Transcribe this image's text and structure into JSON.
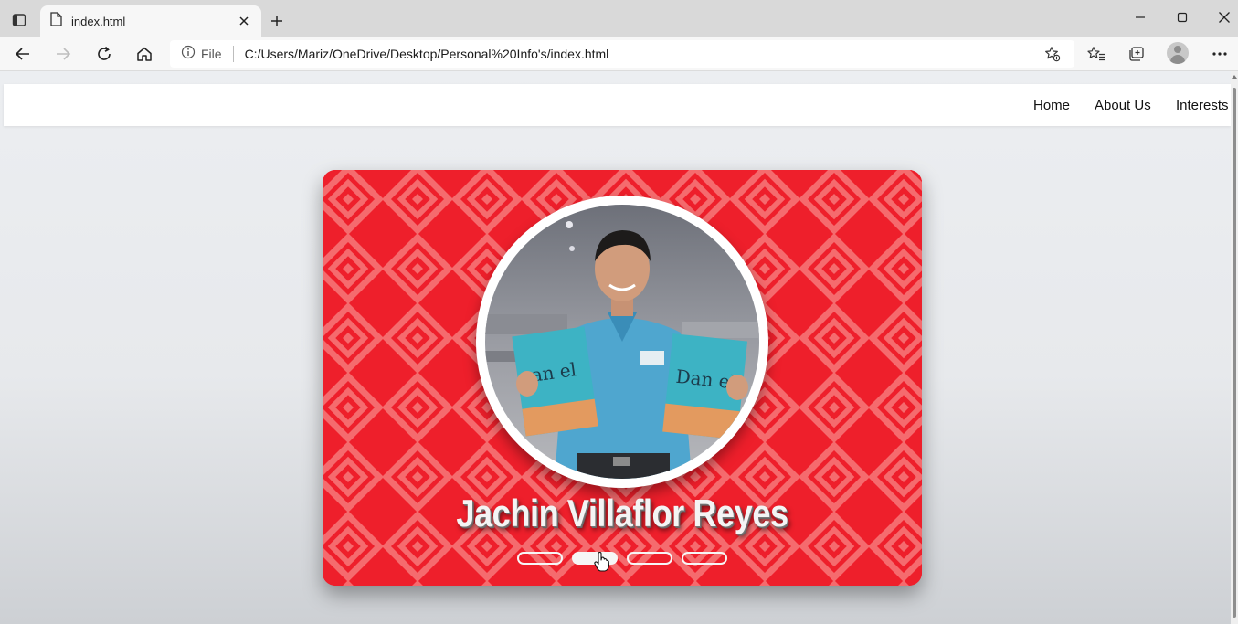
{
  "browser": {
    "tab_title": "index.html",
    "address_prefix": "File",
    "url": "C:/Users/Mariz/OneDrive/Desktop/Personal%20Info's/index.html"
  },
  "nav": {
    "links": [
      {
        "label": "Home",
        "active": true
      },
      {
        "label": "About Us",
        "active": false
      },
      {
        "label": "Interests",
        "active": false
      }
    ]
  },
  "hero": {
    "name": "Jachin Villaflor Reyes",
    "slides_total": 4,
    "active_slide": 2,
    "book_title_left": "an el",
    "book_title_right": "Dan el"
  },
  "colors": {
    "card_red": "#ee1f2b",
    "pattern_stripe": "#f56b6e",
    "shirt_blue": "#4fa6cf",
    "book_teal": "#3db3c4"
  },
  "icons": [
    "sidebar-toggle-icon",
    "page-icon",
    "close-icon",
    "plus-icon",
    "minimize-icon",
    "maximize-icon",
    "window-close-icon",
    "back-arrow-icon",
    "forward-arrow-icon",
    "refresh-icon",
    "home-icon",
    "info-icon",
    "add-favorite-icon",
    "favorites-icon",
    "collections-icon",
    "profile-icon",
    "more-icon",
    "hand-cursor-icon"
  ]
}
